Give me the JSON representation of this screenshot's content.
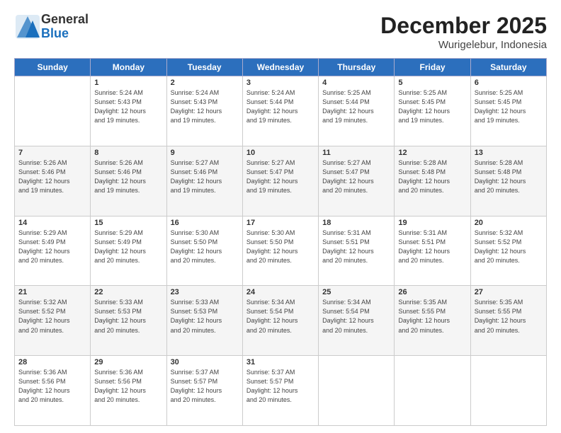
{
  "header": {
    "logo_general": "General",
    "logo_blue": "Blue",
    "month_title": "December 2025",
    "location": "Wurigelebur, Indonesia"
  },
  "days_of_week": [
    "Sunday",
    "Monday",
    "Tuesday",
    "Wednesday",
    "Thursday",
    "Friday",
    "Saturday"
  ],
  "weeks": [
    [
      {
        "day": "",
        "info": ""
      },
      {
        "day": "1",
        "info": "Sunrise: 5:24 AM\nSunset: 5:43 PM\nDaylight: 12 hours\nand 19 minutes."
      },
      {
        "day": "2",
        "info": "Sunrise: 5:24 AM\nSunset: 5:43 PM\nDaylight: 12 hours\nand 19 minutes."
      },
      {
        "day": "3",
        "info": "Sunrise: 5:24 AM\nSunset: 5:44 PM\nDaylight: 12 hours\nand 19 minutes."
      },
      {
        "day": "4",
        "info": "Sunrise: 5:25 AM\nSunset: 5:44 PM\nDaylight: 12 hours\nand 19 minutes."
      },
      {
        "day": "5",
        "info": "Sunrise: 5:25 AM\nSunset: 5:45 PM\nDaylight: 12 hours\nand 19 minutes."
      },
      {
        "day": "6",
        "info": "Sunrise: 5:25 AM\nSunset: 5:45 PM\nDaylight: 12 hours\nand 19 minutes."
      }
    ],
    [
      {
        "day": "7",
        "info": "Sunrise: 5:26 AM\nSunset: 5:46 PM\nDaylight: 12 hours\nand 19 minutes."
      },
      {
        "day": "8",
        "info": "Sunrise: 5:26 AM\nSunset: 5:46 PM\nDaylight: 12 hours\nand 19 minutes."
      },
      {
        "day": "9",
        "info": "Sunrise: 5:27 AM\nSunset: 5:46 PM\nDaylight: 12 hours\nand 19 minutes."
      },
      {
        "day": "10",
        "info": "Sunrise: 5:27 AM\nSunset: 5:47 PM\nDaylight: 12 hours\nand 19 minutes."
      },
      {
        "day": "11",
        "info": "Sunrise: 5:27 AM\nSunset: 5:47 PM\nDaylight: 12 hours\nand 20 minutes."
      },
      {
        "day": "12",
        "info": "Sunrise: 5:28 AM\nSunset: 5:48 PM\nDaylight: 12 hours\nand 20 minutes."
      },
      {
        "day": "13",
        "info": "Sunrise: 5:28 AM\nSunset: 5:48 PM\nDaylight: 12 hours\nand 20 minutes."
      }
    ],
    [
      {
        "day": "14",
        "info": "Sunrise: 5:29 AM\nSunset: 5:49 PM\nDaylight: 12 hours\nand 20 minutes."
      },
      {
        "day": "15",
        "info": "Sunrise: 5:29 AM\nSunset: 5:49 PM\nDaylight: 12 hours\nand 20 minutes."
      },
      {
        "day": "16",
        "info": "Sunrise: 5:30 AM\nSunset: 5:50 PM\nDaylight: 12 hours\nand 20 minutes."
      },
      {
        "day": "17",
        "info": "Sunrise: 5:30 AM\nSunset: 5:50 PM\nDaylight: 12 hours\nand 20 minutes."
      },
      {
        "day": "18",
        "info": "Sunrise: 5:31 AM\nSunset: 5:51 PM\nDaylight: 12 hours\nand 20 minutes."
      },
      {
        "day": "19",
        "info": "Sunrise: 5:31 AM\nSunset: 5:51 PM\nDaylight: 12 hours\nand 20 minutes."
      },
      {
        "day": "20",
        "info": "Sunrise: 5:32 AM\nSunset: 5:52 PM\nDaylight: 12 hours\nand 20 minutes."
      }
    ],
    [
      {
        "day": "21",
        "info": "Sunrise: 5:32 AM\nSunset: 5:52 PM\nDaylight: 12 hours\nand 20 minutes."
      },
      {
        "day": "22",
        "info": "Sunrise: 5:33 AM\nSunset: 5:53 PM\nDaylight: 12 hours\nand 20 minutes."
      },
      {
        "day": "23",
        "info": "Sunrise: 5:33 AM\nSunset: 5:53 PM\nDaylight: 12 hours\nand 20 minutes."
      },
      {
        "day": "24",
        "info": "Sunrise: 5:34 AM\nSunset: 5:54 PM\nDaylight: 12 hours\nand 20 minutes."
      },
      {
        "day": "25",
        "info": "Sunrise: 5:34 AM\nSunset: 5:54 PM\nDaylight: 12 hours\nand 20 minutes."
      },
      {
        "day": "26",
        "info": "Sunrise: 5:35 AM\nSunset: 5:55 PM\nDaylight: 12 hours\nand 20 minutes."
      },
      {
        "day": "27",
        "info": "Sunrise: 5:35 AM\nSunset: 5:55 PM\nDaylight: 12 hours\nand 20 minutes."
      }
    ],
    [
      {
        "day": "28",
        "info": "Sunrise: 5:36 AM\nSunset: 5:56 PM\nDaylight: 12 hours\nand 20 minutes."
      },
      {
        "day": "29",
        "info": "Sunrise: 5:36 AM\nSunset: 5:56 PM\nDaylight: 12 hours\nand 20 minutes."
      },
      {
        "day": "30",
        "info": "Sunrise: 5:37 AM\nSunset: 5:57 PM\nDaylight: 12 hours\nand 20 minutes."
      },
      {
        "day": "31",
        "info": "Sunrise: 5:37 AM\nSunset: 5:57 PM\nDaylight: 12 hours\nand 20 minutes."
      },
      {
        "day": "",
        "info": ""
      },
      {
        "day": "",
        "info": ""
      },
      {
        "day": "",
        "info": ""
      }
    ]
  ]
}
